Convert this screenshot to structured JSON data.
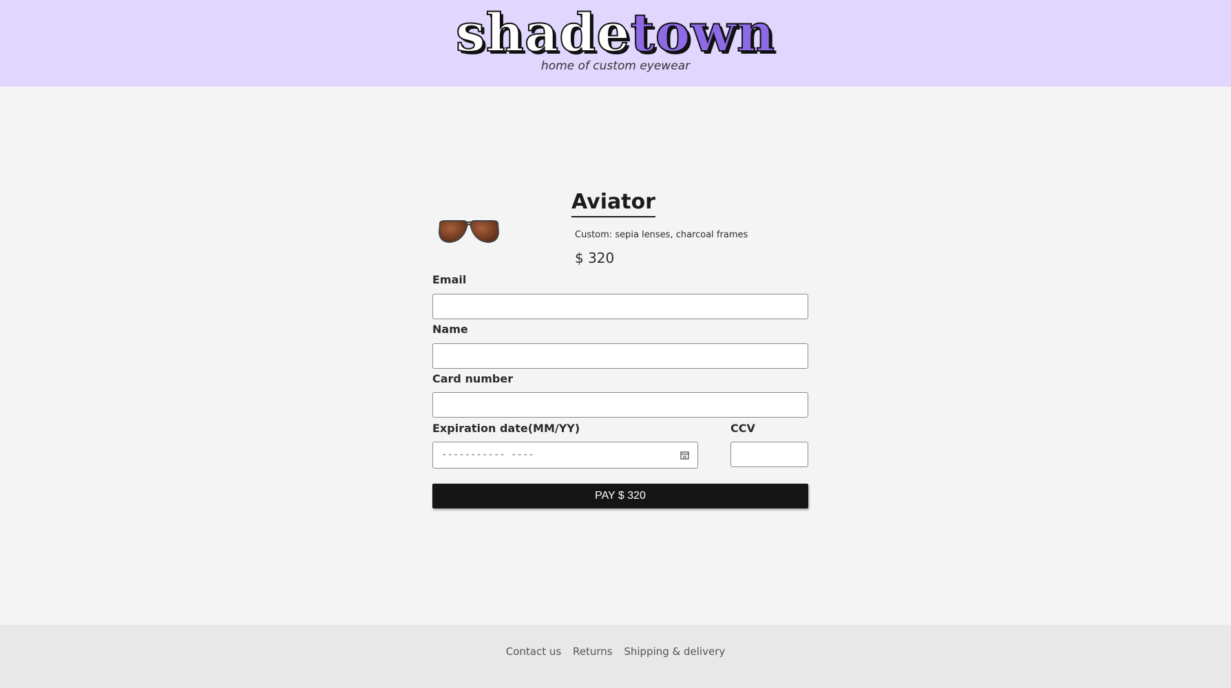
{
  "header": {
    "logo_part1": "shade",
    "logo_part2": "town",
    "tagline": "home of custom eyewear",
    "background_color": "#e0d6fe",
    "accent_color": "#8f6ae6"
  },
  "product": {
    "image_icon": "aviator-sunglasses-icon",
    "name": "Aviator",
    "description": "Custom: sepia lenses, charcoal frames",
    "price": "$ 320"
  },
  "form": {
    "email_label": "Email",
    "email_value": "",
    "name_label": "Name",
    "name_value": "",
    "card_label": "Card number",
    "card_value": "",
    "expiration_label": "Expiration date(MM/YY)",
    "expiration_placeholder": "----------- ----",
    "ccv_label": "CCV",
    "ccv_value": "",
    "pay_button_label": "PAY $ 320"
  },
  "footer": {
    "links": [
      "Contact us",
      "Returns",
      "Shipping & delivery"
    ]
  }
}
